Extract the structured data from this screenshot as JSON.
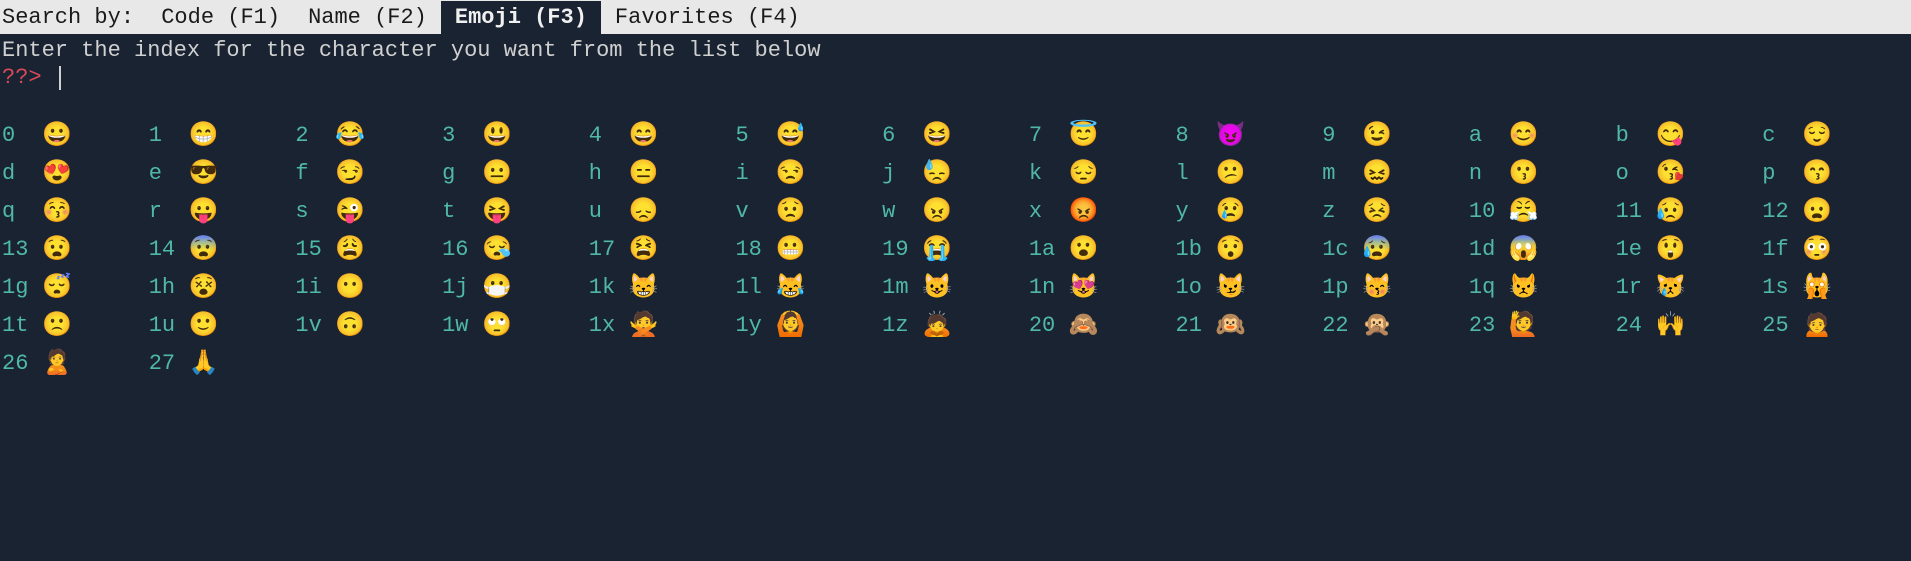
{
  "tab_bar": {
    "prefix": "Search by: ",
    "tabs": [
      {
        "label": "Code (F1)",
        "active": false
      },
      {
        "label": "Name (F2)",
        "active": false
      },
      {
        "label": "Emoji (F3)",
        "active": true
      },
      {
        "label": "Favorites (F4)",
        "active": false
      }
    ]
  },
  "instruction": "Enter the index for the character you want from the list below",
  "prompt": "??> ",
  "emoji_list": [
    {
      "index": "0",
      "char": "😀"
    },
    {
      "index": "1",
      "char": "😁"
    },
    {
      "index": "2",
      "char": "😂"
    },
    {
      "index": "3",
      "char": "😃"
    },
    {
      "index": "4",
      "char": "😄"
    },
    {
      "index": "5",
      "char": "😅"
    },
    {
      "index": "6",
      "char": "😆"
    },
    {
      "index": "7",
      "char": "😇"
    },
    {
      "index": "8",
      "char": "😈"
    },
    {
      "index": "9",
      "char": "😉"
    },
    {
      "index": "a",
      "char": "😊"
    },
    {
      "index": "b",
      "char": "😋"
    },
    {
      "index": "c",
      "char": "😌"
    },
    {
      "index": "d",
      "char": "😍"
    },
    {
      "index": "e",
      "char": "😎"
    },
    {
      "index": "f",
      "char": "😏"
    },
    {
      "index": "g",
      "char": "😐"
    },
    {
      "index": "h",
      "char": "😑"
    },
    {
      "index": "i",
      "char": "😒"
    },
    {
      "index": "j",
      "char": "😓"
    },
    {
      "index": "k",
      "char": "😔"
    },
    {
      "index": "l",
      "char": "😕"
    },
    {
      "index": "m",
      "char": "😖"
    },
    {
      "index": "n",
      "char": "😗"
    },
    {
      "index": "o",
      "char": "😘"
    },
    {
      "index": "p",
      "char": "😙"
    },
    {
      "index": "q",
      "char": "😚"
    },
    {
      "index": "r",
      "char": "😛"
    },
    {
      "index": "s",
      "char": "😜"
    },
    {
      "index": "t",
      "char": "😝"
    },
    {
      "index": "u",
      "char": "😞"
    },
    {
      "index": "v",
      "char": "😟"
    },
    {
      "index": "w",
      "char": "😠"
    },
    {
      "index": "x",
      "char": "😡"
    },
    {
      "index": "y",
      "char": "😢"
    },
    {
      "index": "z",
      "char": "😣"
    },
    {
      "index": "10",
      "char": "😤"
    },
    {
      "index": "11",
      "char": "😥"
    },
    {
      "index": "12",
      "char": "😦"
    },
    {
      "index": "13",
      "char": "😧"
    },
    {
      "index": "14",
      "char": "😨"
    },
    {
      "index": "15",
      "char": "😩"
    },
    {
      "index": "16",
      "char": "😪"
    },
    {
      "index": "17",
      "char": "😫"
    },
    {
      "index": "18",
      "char": "😬"
    },
    {
      "index": "19",
      "char": "😭"
    },
    {
      "index": "1a",
      "char": "😮"
    },
    {
      "index": "1b",
      "char": "😯"
    },
    {
      "index": "1c",
      "char": "😰"
    },
    {
      "index": "1d",
      "char": "😱"
    },
    {
      "index": "1e",
      "char": "😲"
    },
    {
      "index": "1f",
      "char": "😳"
    },
    {
      "index": "1g",
      "char": "😴"
    },
    {
      "index": "1h",
      "char": "😵"
    },
    {
      "index": "1i",
      "char": "😶"
    },
    {
      "index": "1j",
      "char": "😷"
    },
    {
      "index": "1k",
      "char": "😸"
    },
    {
      "index": "1l",
      "char": "😹"
    },
    {
      "index": "1m",
      "char": "😺"
    },
    {
      "index": "1n",
      "char": "😻"
    },
    {
      "index": "1o",
      "char": "😼"
    },
    {
      "index": "1p",
      "char": "😽"
    },
    {
      "index": "1q",
      "char": "😾"
    },
    {
      "index": "1r",
      "char": "😿"
    },
    {
      "index": "1s",
      "char": "🙀"
    },
    {
      "index": "1t",
      "char": "🙁"
    },
    {
      "index": "1u",
      "char": "🙂"
    },
    {
      "index": "1v",
      "char": "🙃"
    },
    {
      "index": "1w",
      "char": "🙄"
    },
    {
      "index": "1x",
      "char": "🙅"
    },
    {
      "index": "1y",
      "char": "🙆"
    },
    {
      "index": "1z",
      "char": "🙇"
    },
    {
      "index": "20",
      "char": "🙈"
    },
    {
      "index": "21",
      "char": "🙉"
    },
    {
      "index": "22",
      "char": "🙊"
    },
    {
      "index": "23",
      "char": "🙋"
    },
    {
      "index": "24",
      "char": "🙌"
    },
    {
      "index": "25",
      "char": "🙍"
    },
    {
      "index": "26",
      "char": "🙎"
    },
    {
      "index": "27",
      "char": "🙏"
    }
  ]
}
